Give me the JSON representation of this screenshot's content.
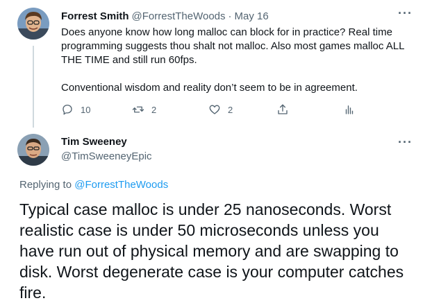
{
  "tweet1": {
    "name": "Forrest Smith",
    "handle": "@ForrestTheWoods",
    "separator": "·",
    "date": "May 16",
    "text_p1": "Does anyone know how long malloc can block for in practice? Real time programming suggests thou shalt not malloc. Also most games malloc ALL THE TIME and still run 60fps.",
    "text_p2": "Conventional wisdom and reality don’t seem to be in agreement.",
    "reply_count": "10",
    "retweet_count": "2",
    "like_count": "2",
    "more_label": "···",
    "icons": [
      "reply-icon",
      "retweet-icon",
      "like-icon",
      "share-icon",
      "analytics-icon"
    ]
  },
  "tweet2": {
    "name": "Tim Sweeney",
    "handle": "@TimSweeneyEpic",
    "more_label": "···",
    "replying_prefix": "Replying to",
    "replying_handle": "@ForrestTheWoods",
    "text": "Typical case malloc is under 25 nanoseconds. Worst realistic case is under 50 microseconds unless you have run out of physical memory and are swapping to disk. Worst degenerate case is your computer catches fire."
  },
  "colors": {
    "text": "#0f1419",
    "muted": "#536471",
    "link": "#1d9bf0",
    "thread_line": "#cfd9de"
  }
}
